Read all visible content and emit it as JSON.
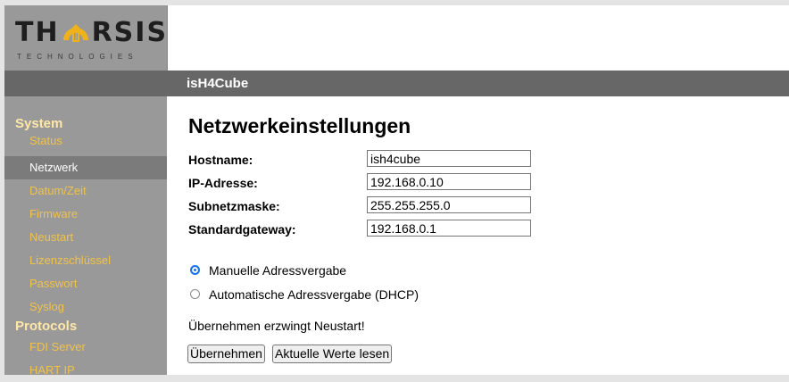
{
  "brand": {
    "name_part1": "TH",
    "name_part2": "RSIS",
    "subtitle": "TECHNOLOGIES",
    "accent": "#f0b21b"
  },
  "header": {
    "device_name": "isH4Cube"
  },
  "sidebar": {
    "sections": [
      {
        "title": "System",
        "items": [
          {
            "label": "Status",
            "active": false
          },
          {
            "label": "Netzwerk",
            "active": true
          },
          {
            "label": "Datum/Zeit",
            "active": false
          },
          {
            "label": "Firmware",
            "active": false
          },
          {
            "label": "Neustart",
            "active": false
          },
          {
            "label": "Lizenzschlüssel",
            "active": false
          },
          {
            "label": "Passwort",
            "active": false
          },
          {
            "label": "Syslog",
            "active": false
          }
        ]
      },
      {
        "title": "Protocols",
        "items": [
          {
            "label": "FDI Server",
            "active": false
          },
          {
            "label": "HART IP",
            "active": false
          }
        ]
      }
    ]
  },
  "main": {
    "title": "Netzwerkeinstellungen",
    "fields": [
      {
        "label": "Hostname:",
        "value": "ish4cube"
      },
      {
        "label": "IP-Adresse:",
        "value": "192.168.0.10"
      },
      {
        "label": "Subnetzmaske:",
        "value": "255.255.255.0"
      },
      {
        "label": "Standardgateway:",
        "value": "192.168.0.1"
      }
    ],
    "mode_options": [
      {
        "label": "Manuelle Adressvergabe",
        "selected": true
      },
      {
        "label": "Automatische Adressvergabe (DHCP)",
        "selected": false
      }
    ],
    "note": "Übernehmen erzwingt Neustart!",
    "apply_button": "Übernehmen",
    "read_button": "Aktuelle Werte lesen"
  },
  "colors": {
    "sidebar_bg": "#999999",
    "header_bar": "#676767",
    "section_title": "#ffe7a8",
    "menu_item": "#f0c24a",
    "active_item_bg": "#7b7b7b"
  }
}
